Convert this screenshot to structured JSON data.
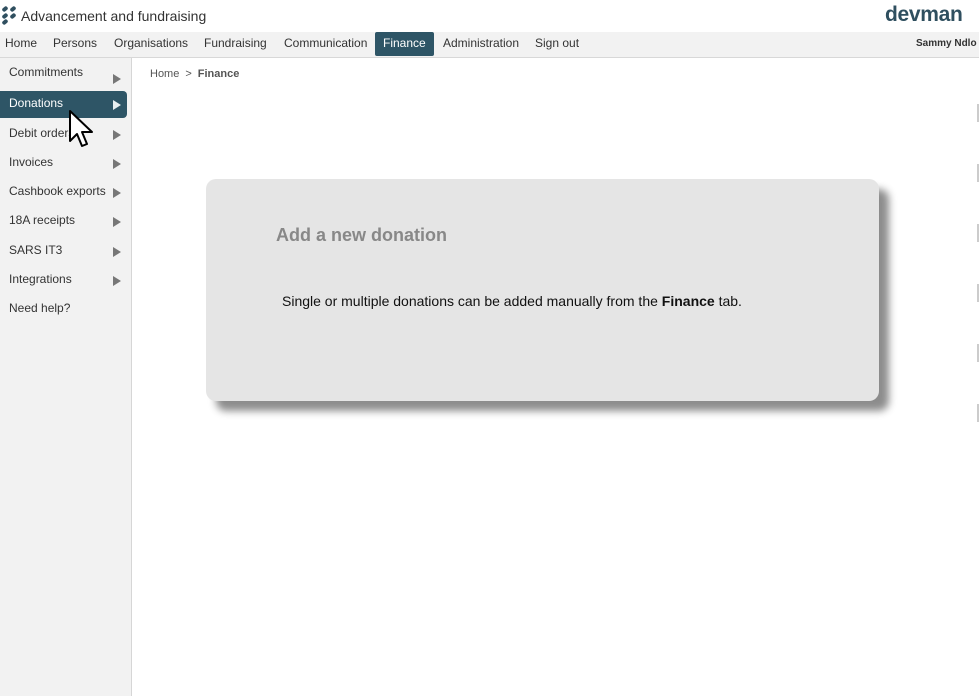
{
  "window": {
    "title": "Advancement and fundraising",
    "brand": "devman"
  },
  "nav": {
    "items": [
      {
        "label": "Home",
        "active": false
      },
      {
        "label": "Persons",
        "active": false
      },
      {
        "label": "Organisations",
        "active": false
      },
      {
        "label": "Fundraising",
        "active": false
      },
      {
        "label": "Communication",
        "active": false
      },
      {
        "label": "Finance",
        "active": true
      },
      {
        "label": "Administration",
        "active": false
      },
      {
        "label": "Sign out",
        "active": false
      }
    ],
    "user": "Sammy Ndlo"
  },
  "sidebar": {
    "items": [
      {
        "label": "Commitments",
        "has_arrow": true
      },
      {
        "label": "Donations",
        "has_arrow": true,
        "active": true
      },
      {
        "label": "Debit orders",
        "has_arrow": true
      },
      {
        "label": "Invoices",
        "has_arrow": true
      },
      {
        "label": "Cashbook exports",
        "has_arrow": true
      },
      {
        "label": "18A receipts",
        "has_arrow": true
      },
      {
        "label": "SARS IT3",
        "has_arrow": true
      },
      {
        "label": "Integrations",
        "has_arrow": true
      },
      {
        "label": "Need help?",
        "has_arrow": false
      }
    ]
  },
  "breadcrumb": {
    "home": "Home",
    "separator": ">",
    "current": "Finance"
  },
  "card": {
    "title": "Add a new donation",
    "text_before": "Single or multiple donations can be added manually from the ",
    "text_bold": "Finance",
    "text_after": " tab."
  },
  "colors": {
    "accent": "#2e5566",
    "brand": "#2f4f5f",
    "card_bg": "#e5e5e5"
  }
}
